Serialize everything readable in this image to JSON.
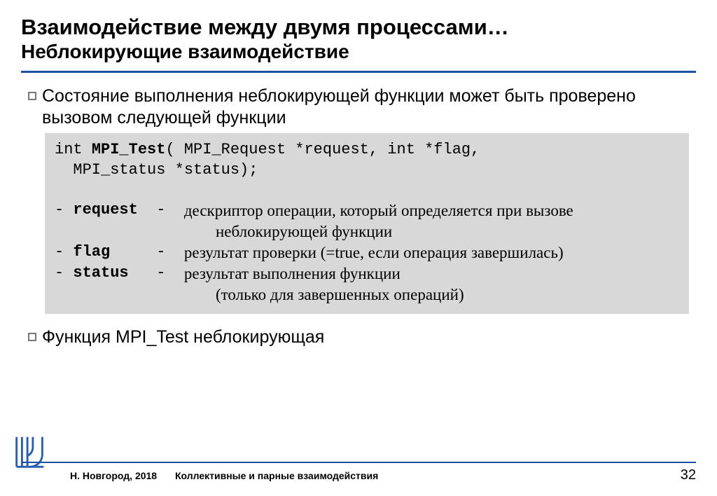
{
  "title": {
    "line1": "Взаимодействие между двумя процессами…",
    "line2": "Неблокирующие взаимодействие"
  },
  "bullets": {
    "b1": "Состояние выполнения неблокирующей функции может быть проверено вызовом следующей функции",
    "b2": "Функция MPI_Test неблокирующая"
  },
  "code": {
    "sig_l1a": "int ",
    "sig_l1b": "MPI_Test",
    "sig_l1c": "( MPI_Request *request, int *flag,",
    "sig_l2": "  MPI_status *status);",
    "p1_key": "- request  -  ",
    "p1_desc": "дескриптор операции, который определяется при вызове",
    "p1_cont": "неблокирующей функции",
    "p2_key": "- flag     -  ",
    "p2_desc": "результат проверки (=true, если операция завершилась)",
    "p3_key": "- status   -  ",
    "p3_desc": "результат выполнения функции",
    "p3_cont": "(только для завершенных операций)"
  },
  "footer": {
    "left": "Н. Новгород, 2018",
    "center": "Коллективные и парные взаимодействия",
    "page": "32"
  }
}
